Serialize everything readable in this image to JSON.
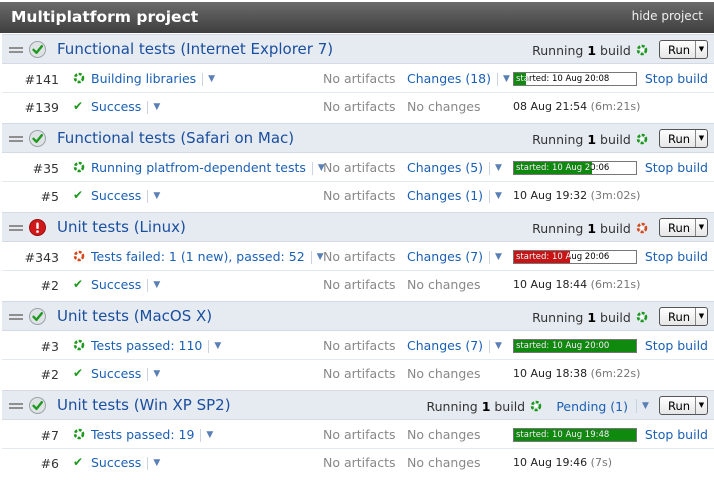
{
  "project": {
    "title": "Multiplatform project",
    "hide_label": "hide project"
  },
  "run_label": "Run",
  "colors": {
    "success": "#1d9a1d",
    "failure": "#d01a1a",
    "link": "#1a5fb4",
    "progress_green": "#0f8a0f",
    "progress_red": "#c81414"
  },
  "configs": [
    {
      "name": "Functional tests (Internet Explorer 7)",
      "status": "success",
      "running_prefix": "Running",
      "running_count": "1",
      "running_suffix": "build",
      "builds": [
        {
          "number": "#141",
          "icon": "running-icon",
          "text": "Building libraries",
          "artifacts": "No artifacts",
          "changes": "Changes (18)",
          "changes_link": true,
          "progress": {
            "label": "started: 10 Aug 20:08",
            "fraction": 0.1,
            "color": "green"
          },
          "action": "Stop build"
        },
        {
          "number": "#139",
          "icon": "check-icon",
          "text": "Success",
          "artifacts": "No artifacts",
          "changes": "No changes",
          "changes_link": false,
          "date": "08 Aug 21:54",
          "duration": "(6m:21s)"
        }
      ]
    },
    {
      "name": "Functional tests (Safari on Mac)",
      "status": "success",
      "running_prefix": "Running",
      "running_count": "1",
      "running_suffix": "build",
      "builds": [
        {
          "number": "#35",
          "icon": "running-icon",
          "text": "Running platfrom-dependent tests",
          "artifacts": "No artifacts",
          "changes": "Changes (5)",
          "changes_link": true,
          "progress": {
            "label": "started: 10 Aug 20:06",
            "fraction": 0.64,
            "color": "green"
          },
          "action": "Stop build"
        },
        {
          "number": "#5",
          "icon": "check-icon",
          "text": "Success",
          "artifacts": "No artifacts",
          "changes": "Changes (1)",
          "changes_link": true,
          "date": "10 Aug 19:32",
          "duration": "(3m:02s)"
        }
      ]
    },
    {
      "name": "Unit tests (Linux)",
      "status": "failure",
      "running_prefix": "Running",
      "running_count": "1",
      "running_suffix": "build",
      "builds": [
        {
          "number": "#343",
          "icon": "failing-icon",
          "text": "Tests failed: 1 (1 new), passed: 52",
          "artifacts": "No artifacts",
          "changes": "Changes (7)",
          "changes_link": true,
          "progress": {
            "label": "started: 10 Aug 20:06",
            "fraction": 0.46,
            "color": "red"
          },
          "action": "Stop build"
        },
        {
          "number": "#2",
          "icon": "check-icon",
          "text": "Success",
          "artifacts": "No artifacts",
          "changes": "No changes",
          "changes_link": false,
          "date": "10 Aug 18:44",
          "duration": "(6m:21s)"
        }
      ]
    },
    {
      "name": "Unit tests (MacOS X)",
      "status": "success",
      "running_prefix": "Running",
      "running_count": "1",
      "running_suffix": "build",
      "builds": [
        {
          "number": "#3",
          "icon": "running-icon",
          "text": "Tests passed: 110",
          "artifacts": "No artifacts",
          "changes": "Changes (7)",
          "changes_link": true,
          "progress": {
            "label": "started: 10 Aug 20:00",
            "fraction": 1.0,
            "color": "green"
          },
          "action": "Stop build"
        },
        {
          "number": "#2",
          "icon": "check-icon",
          "text": "Success",
          "artifacts": "No artifacts",
          "changes": "No changes",
          "changes_link": false,
          "date": "10 Aug 18:38",
          "duration": "(6m:22s)"
        }
      ]
    },
    {
      "name": "Unit tests (Win XP SP2)",
      "status": "success",
      "running_prefix": "Running",
      "running_count": "1",
      "running_suffix": "build",
      "pending": "Pending (1)",
      "builds": [
        {
          "number": "#7",
          "icon": "running-icon",
          "text": "Tests passed: 19",
          "artifacts": "No artifacts",
          "changes": "No changes",
          "changes_link": false,
          "progress": {
            "label": "started: 10 Aug 19:48",
            "fraction": 1.0,
            "color": "green"
          },
          "action": "Stop build"
        },
        {
          "number": "#6",
          "icon": "check-icon",
          "text": "Success",
          "artifacts": "No artifacts",
          "changes": "No changes",
          "changes_link": false,
          "date": "10 Aug 19:46",
          "duration": "(7s)"
        }
      ]
    }
  ]
}
